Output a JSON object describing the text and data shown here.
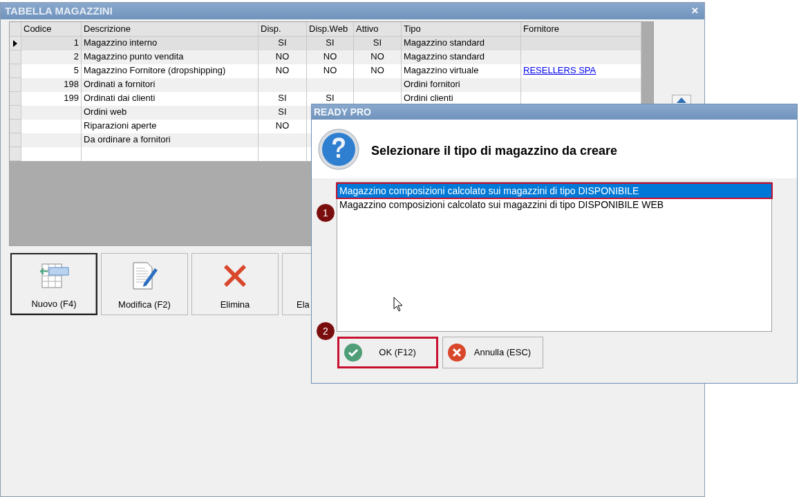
{
  "window": {
    "title": "TABELLA MAGAZZINI",
    "close": "✕"
  },
  "table": {
    "columns": [
      "Codice",
      "Descrizione",
      "Disp.",
      "Disp.Web",
      "Attivo",
      "Tipo",
      "Fornitore"
    ],
    "rows": [
      {
        "selected": true,
        "codice": "1",
        "descrizione": "Magazzino interno",
        "disp": "SI",
        "disp_web": "SI",
        "attivo": "SI",
        "tipo": "Magazzino standard"
      },
      {
        "selected": false,
        "codice": "2",
        "descrizione": "Magazzino punto vendita",
        "disp": "NO",
        "disp_web": "NO",
        "attivo": "NO",
        "tipo": "Magazzino standard"
      },
      {
        "selected": false,
        "codice": "5",
        "descrizione": "Magazzino Fornitore (dropshipping)",
        "disp": "NO",
        "disp_web": "NO",
        "attivo": "NO",
        "tipo": "Magazzino virtuale",
        "fornitore": "RESELLERS SPA"
      },
      {
        "selected": false,
        "codice": "198",
        "descrizione": "Ordinati a fornitori",
        "tipo": "Ordini fornitori"
      },
      {
        "selected": false,
        "codice": "199",
        "descrizione": "Ordinati dai clienti",
        "disp": "SI",
        "disp_web": "SI",
        "tipo": "Ordini clienti"
      },
      {
        "selected": false,
        "descrizione": "Ordini web",
        "disp": "SI"
      },
      {
        "selected": false,
        "descrizione": "Riparazioni aperte",
        "disp": "NO"
      },
      {
        "selected": false,
        "descrizione": "Da ordinare a fornitori"
      }
    ]
  },
  "buttons": [
    {
      "kind": "new",
      "label": "Nuovo (F4)",
      "focused": true
    },
    {
      "kind": "edit",
      "label": "Modifica (F2)",
      "focused": false
    },
    {
      "kind": "delete",
      "label": "Elimina",
      "focused": false
    },
    {
      "kind": "other",
      "label": "Ela",
      "focused": false
    }
  ],
  "dialog": {
    "title": "READY PRO",
    "message": "Selezionare il tipo di magazzino da creare",
    "options": [
      {
        "label": "Magazzino composizioni calcolato sui magazzini di tipo DISPONIBILE",
        "selected": true,
        "highlighted": true
      },
      {
        "label": "Magazzino composizioni calcolato sui magazzini di tipo DISPONIBILE WEB",
        "selected": false,
        "highlighted": false
      }
    ],
    "buttons": [
      {
        "kind": "ok",
        "label": "OK (F12)",
        "highlighted": true
      },
      {
        "kind": "cancel",
        "label": "Annulla (ESC)",
        "highlighted": false
      }
    ],
    "annotations": [
      {
        "label": "1"
      },
      {
        "label": "2"
      }
    ]
  }
}
